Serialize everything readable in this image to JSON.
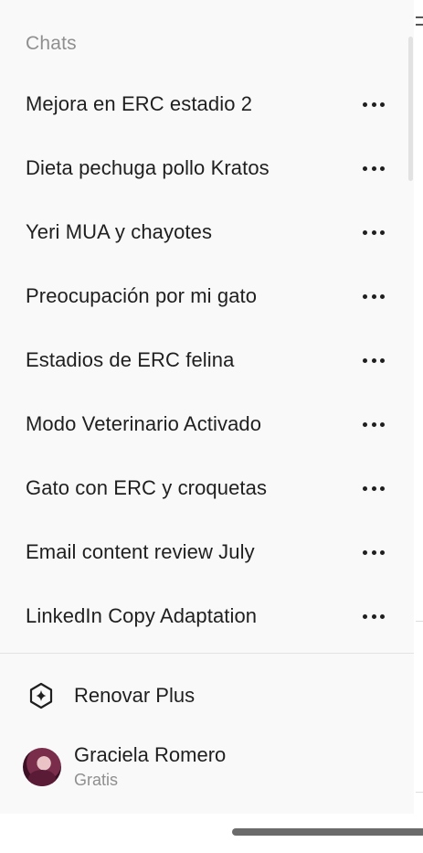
{
  "drawer": {
    "section_title": "Chats",
    "chats": [
      {
        "title": "Mejora en ERC estadio 2"
      },
      {
        "title": "Dieta pechuga pollo Kratos"
      },
      {
        "title": "Yeri MUA y chayotes"
      },
      {
        "title": "Preocupación por mi gato"
      },
      {
        "title": "Estadios de ERC felina"
      },
      {
        "title": "Modo Veterinario Activado"
      },
      {
        "title": "Gato con ERC y croquetas"
      },
      {
        "title": "Email content review July"
      },
      {
        "title": "LinkedIn Copy Adaptation"
      }
    ],
    "renew": {
      "label": "Renovar Plus",
      "icon": "hexagon-sparkle-icon"
    },
    "user": {
      "name": "Graciela Romero",
      "plan": "Gratis"
    }
  },
  "colors": {
    "drawer_background": "#f9f9f9",
    "text_primary": "#1f1f1f",
    "text_secondary": "#8f8f8f"
  }
}
